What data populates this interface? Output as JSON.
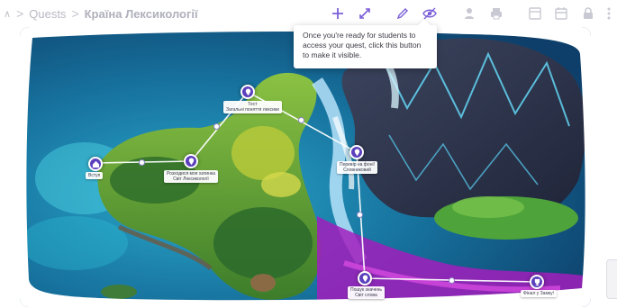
{
  "breadcrumb": {
    "back_glyph": "∧",
    "separator": ">",
    "parent": "Quests",
    "current": "Країна Лексикології"
  },
  "toolbar": {
    "icons": [
      "add-icon",
      "expand-icon",
      "edit-icon",
      "visibility-icon",
      "person-icon",
      "printer-icon",
      "layout-icon",
      "calendar-icon",
      "lock-icon",
      "more-icon"
    ],
    "accent": "#7b5fd8",
    "muted": "#c9c9d3"
  },
  "tooltip": {
    "text": "Once you're ready for students to access your quest, click this button to make it visible."
  },
  "map": {
    "node_color": "#5b3fbd",
    "nodes": [
      {
        "id": "start",
        "icon": "home-icon",
        "label_lines": [
          "Вступ"
        ]
      },
      {
        "id": "n2",
        "icon": "pin-icon",
        "label_lines": [
          "Розходися моя хатинка",
          "Світ Лексикології"
        ]
      },
      {
        "id": "n3",
        "icon": "pin-icon",
        "label_lines": [
          "Тест",
          "Загальні поняття лексики"
        ]
      },
      {
        "id": "n4",
        "icon": "pin-icon",
        "label_lines": [
          "Перевір на фоні!",
          "Словниковий"
        ]
      },
      {
        "id": "n5",
        "icon": "pin-icon",
        "label_lines": [
          "Пошук значень",
          "Світ слова"
        ]
      },
      {
        "id": "end",
        "icon": "trophy-icon",
        "label_lines": [
          "Фінал у Замку!"
        ]
      }
    ]
  }
}
